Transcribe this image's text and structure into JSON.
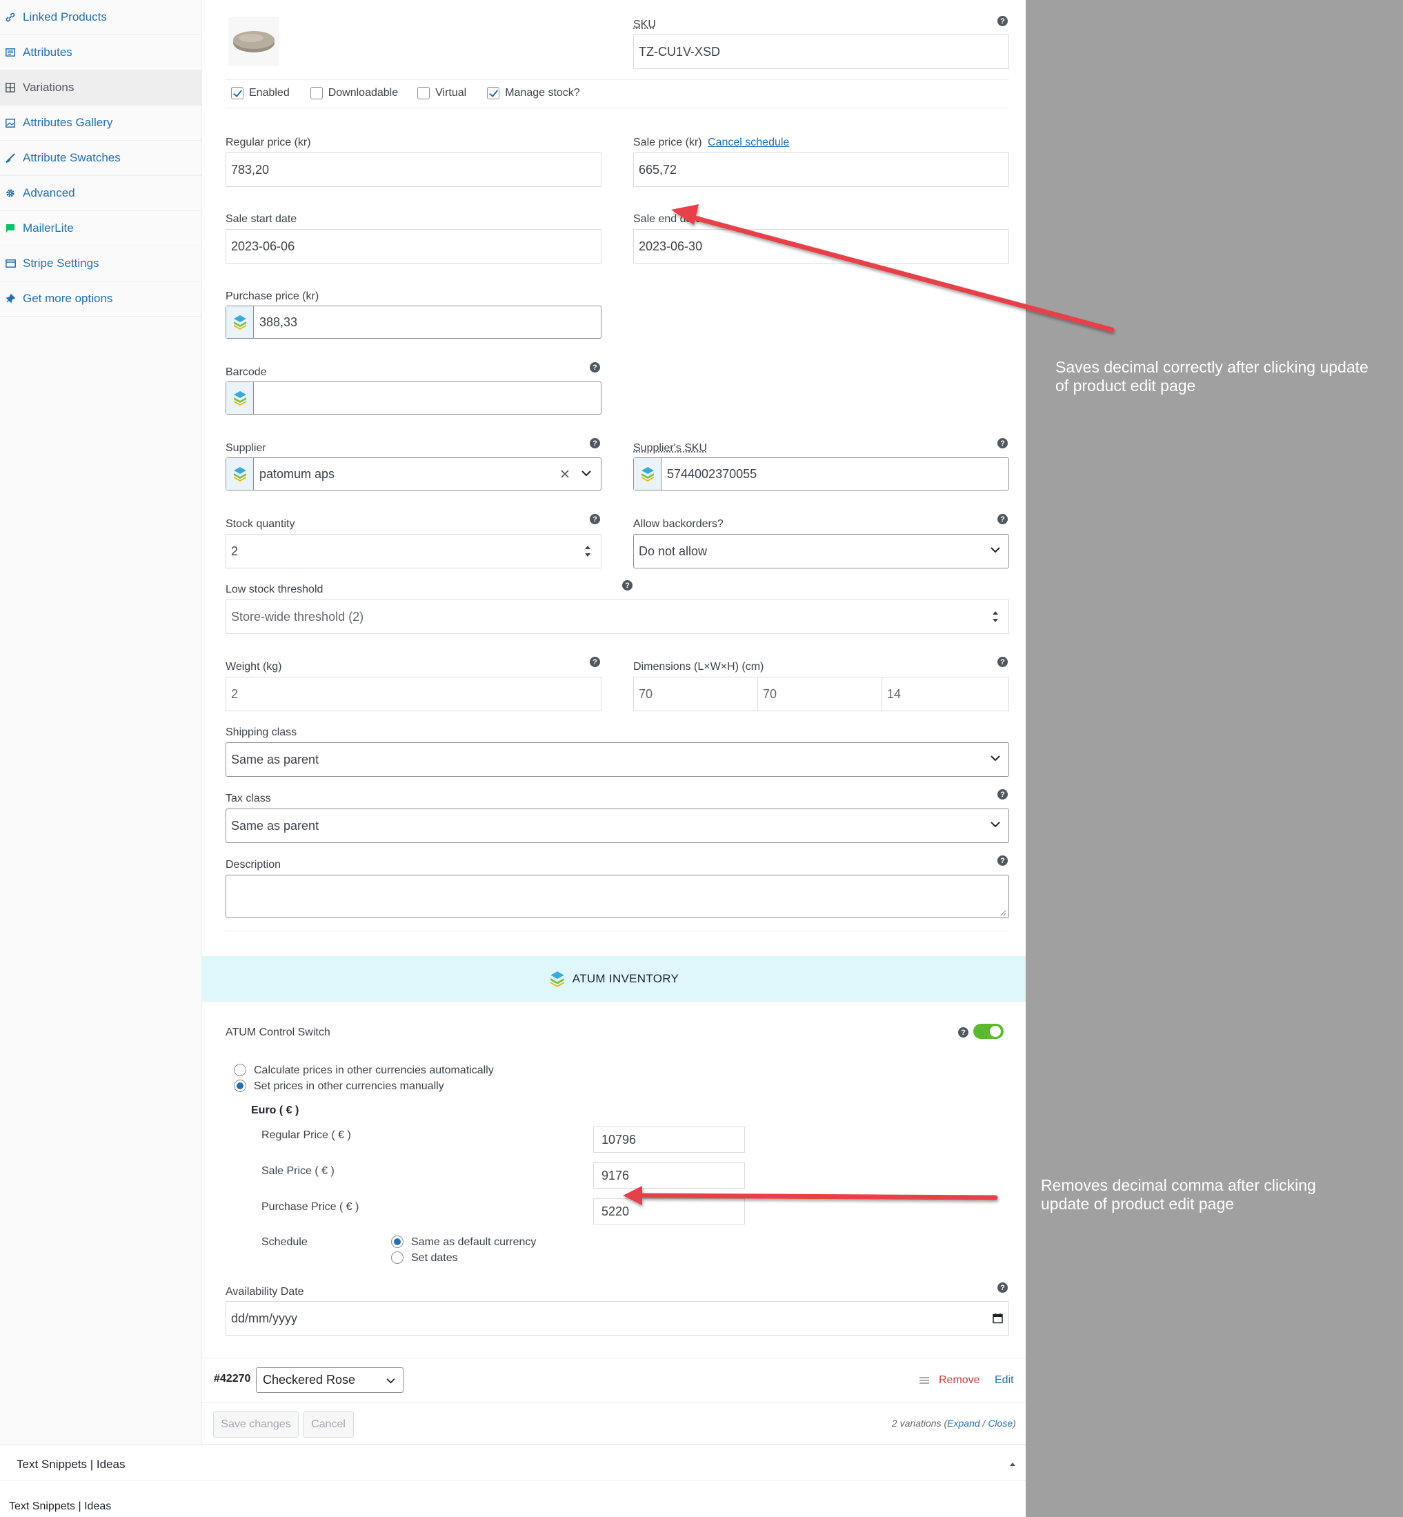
{
  "sidebar": {
    "items": [
      {
        "label": "Linked Products",
        "icon": "link-icon"
      },
      {
        "label": "Attributes",
        "icon": "list-icon"
      },
      {
        "label": "Variations",
        "icon": "grid-icon",
        "active": true
      },
      {
        "label": "Attributes Gallery",
        "icon": "image-icon"
      },
      {
        "label": "Attribute Swatches",
        "icon": "brush-icon"
      },
      {
        "label": "Advanced",
        "icon": "gear-icon"
      },
      {
        "label": "MailerLite",
        "icon": "flag-icon"
      },
      {
        "label": "Stripe Settings",
        "icon": "card-icon"
      },
      {
        "label": "Get more options",
        "icon": "plugin-icon"
      }
    ]
  },
  "variation": {
    "sku_label": "SKU",
    "sku_value": "TZ-CU1V-XSD",
    "checkboxes": {
      "enabled": "Enabled",
      "downloadable": "Downloadable",
      "virtual": "Virtual",
      "manage_stock": "Manage stock?"
    },
    "regular_price_label": "Regular price (kr)",
    "regular_price_value": "783,20",
    "sale_price_label": "Sale price (kr)",
    "cancel_schedule": "Cancel schedule",
    "sale_price_value": "665,72",
    "sale_start_label": "Sale start date",
    "sale_start_value": "2023-06-06",
    "sale_end_label": "Sale end date",
    "sale_end_value": "2023-06-30",
    "purchase_price_label": "Purchase price (kr)",
    "purchase_price_value": "388,33",
    "barcode_label": "Barcode",
    "barcode_value": "",
    "supplier_label": "Supplier",
    "supplier_value": "patomum aps",
    "supplier_sku_label": "Supplier's SKU",
    "supplier_sku_value": "5744002370055",
    "stock_qty_label": "Stock quantity",
    "stock_qty_value": "2",
    "backorders_label": "Allow backorders?",
    "backorders_value": "Do not allow",
    "low_stock_label": "Low stock threshold",
    "low_stock_placeholder": "Store-wide threshold (2)",
    "weight_label": "Weight (kg)",
    "weight_placeholder": "2",
    "dimensions_label": "Dimensions (L×W×H) (cm)",
    "dim_l": "70",
    "dim_w": "70",
    "dim_h": "14",
    "shipping_label": "Shipping class",
    "shipping_value": "Same as parent",
    "tax_label": "Tax class",
    "tax_value": "Same as parent",
    "description_label": "Description",
    "description_value": ""
  },
  "atum": {
    "header": "ATUM INVENTORY",
    "control_switch_label": "ATUM Control Switch",
    "radio_auto": "Calculate prices in other currencies automatically",
    "radio_manual": "Set prices in other currencies manually",
    "currency_title": "Euro ( € )",
    "regular_price_label": "Regular Price ( € )",
    "regular_price_value": "10796",
    "sale_price_label": "Sale Price ( € )",
    "sale_price_value": "9176",
    "purchase_price_label": "Purchase Price ( € )",
    "purchase_price_value": "5220",
    "schedule_label": "Schedule",
    "schedule_same": "Same as default currency",
    "schedule_dates": "Set dates",
    "availability_label": "Availability Date",
    "availability_placeholder": "dd/mm/yyyy"
  },
  "variation_row": {
    "id": "#42270",
    "option": "Checkered Rose",
    "remove": "Remove",
    "edit": "Edit"
  },
  "footer": {
    "save": "Save changes",
    "cancel": "Cancel",
    "variations_count": "2 variations",
    "expand": "Expand",
    "separator": "/",
    "close": "Close",
    "snippets_title": "Text Snippets | Ideas",
    "snippets_bottom": "Text Snippets | Ideas"
  },
  "annotations": {
    "note_top_line1": "Saves decimal correctly after clicking update",
    "note_top_line2": "of product edit page",
    "note_bottom_line1": "Removes decimal comma after clicking",
    "note_bottom_line2": "update of product edit page"
  },
  "colors": {
    "accent": "#2271b1",
    "remove": "#d63638",
    "toggle_on": "#5cb82d",
    "atum_band": "#dff6fb",
    "arrow": "#e8404a",
    "panel_gray": "#a0a0a0"
  }
}
